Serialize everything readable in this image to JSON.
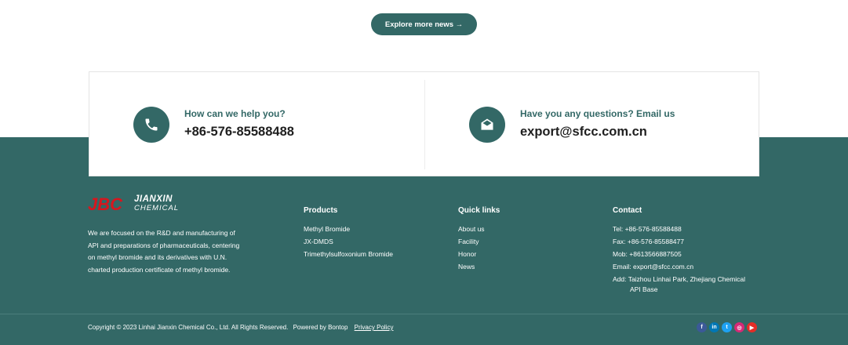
{
  "news": {
    "explore_label": "Explore more news →"
  },
  "contact_card": {
    "phone_label": "How can we help you?",
    "phone_value": "+86-576-85588488",
    "email_label": "Have you any questions?  Email us",
    "email_value": "export@sfcc.com.cn"
  },
  "footer": {
    "logo": {
      "mark": "JBC",
      "line1": "JIANXIN",
      "line2": "CHEMICAL"
    },
    "about": "We are focused on the R&D and manufacturing of API and preparations of pharmaceuticals, centering on methyl bromide and its derivatives with U.N. charted production certificate of methyl bromide.",
    "products": {
      "title": "Products",
      "items": [
        "Methyl Bromide",
        "JX-DMDS",
        "Trimethylsulfoxonium Bromide"
      ]
    },
    "quick_links": {
      "title": "Quick links",
      "items": [
        "About us",
        "Facility",
        "Honor",
        "News"
      ]
    },
    "contact": {
      "title": "Contact",
      "tel": "Tel: +86-576-85588488",
      "fax": "Fax: +86-576-85588477",
      "mob": "Mob: +8613566887505",
      "email": "Email: export@sfcc.com.cn",
      "address_line1": "Add: Taizhou Linhai Park, Zhejiang Chemical",
      "address_line2": "API Base"
    },
    "copyright": "Copyright © 2023  Linhai Jianxin Chemical Co., Ltd. All Rights Reserved.",
    "powered": "Powered by Bontop",
    "privacy": "Privacy Policy",
    "social": [
      {
        "icon": "facebook-icon",
        "glyph": "f",
        "color": "#3b5998"
      },
      {
        "icon": "linkedin-icon",
        "glyph": "in",
        "color": "#0077b5"
      },
      {
        "icon": "twitter-icon",
        "glyph": "t",
        "color": "#1da1f2"
      },
      {
        "icon": "instagram-icon",
        "glyph": "◎",
        "color": "#d62976"
      },
      {
        "icon": "youtube-icon",
        "glyph": "▶",
        "color": "#e52d27"
      }
    ]
  },
  "colors": {
    "brand": "#336866",
    "logo_red": "#d7161e"
  }
}
